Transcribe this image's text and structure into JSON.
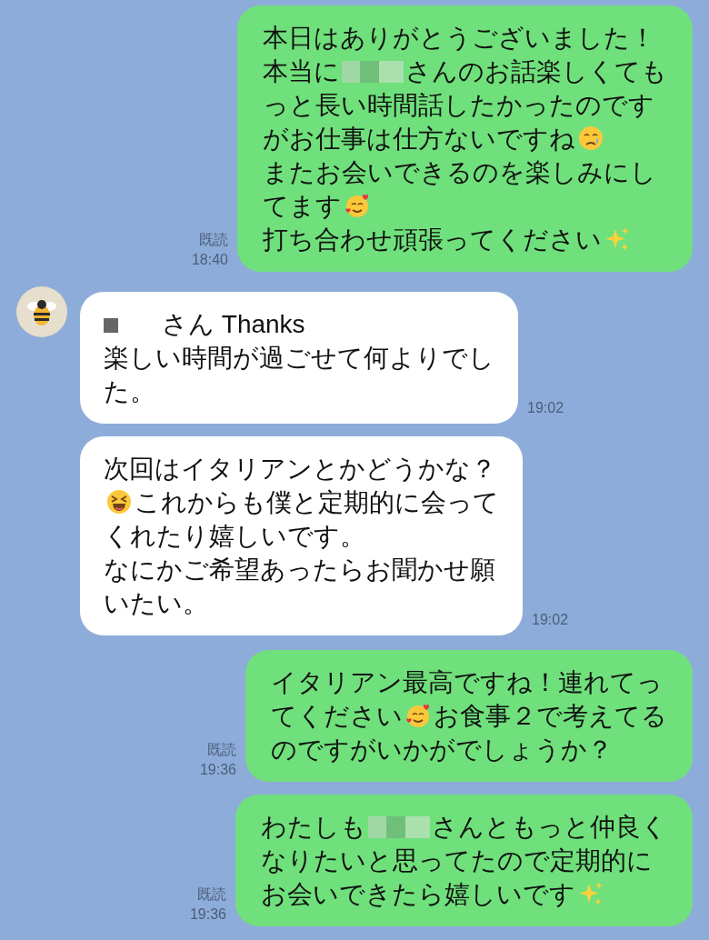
{
  "messages": [
    {
      "kind": "outgoing",
      "read_label": "既読",
      "time": "18:40",
      "lines": [
        [
          {
            "kind": "text",
            "text": "本日はありがとうございました！"
          }
        ],
        [
          {
            "kind": "text",
            "text": "本当に"
          },
          {
            "kind": "redacted-blur"
          },
          {
            "kind": "text",
            "text": "さんのお話楽しくても"
          }
        ],
        [
          {
            "kind": "text",
            "text": "っと長い時間話したかったのです"
          }
        ],
        [
          {
            "kind": "text",
            "text": "がお仕事は仕方ないですね"
          },
          {
            "kind": "emoji-cry"
          }
        ],
        [
          {
            "kind": "text",
            "text": "またお会いできるのを楽しみにし"
          }
        ],
        [
          {
            "kind": "text",
            "text": "てます"
          },
          {
            "kind": "emoji-hearts"
          }
        ],
        [
          {
            "kind": "text",
            "text": "打ち合わせ頑張ってください"
          },
          {
            "kind": "emoji-sparkles"
          }
        ]
      ]
    },
    {
      "kind": "incoming",
      "show_avatar": true,
      "time": "19:02",
      "lines": [
        [
          {
            "kind": "redacted-block"
          },
          {
            "kind": "text",
            "text": "さん Thanks"
          }
        ],
        [
          {
            "kind": "text",
            "text": "楽しい時間が過ごせて何よりでし"
          }
        ],
        [
          {
            "kind": "text",
            "text": "た。"
          }
        ]
      ]
    },
    {
      "kind": "incoming",
      "show_avatar": false,
      "time": "19:02",
      "lines": [
        [
          {
            "kind": "text",
            "text": "次回はイタリアンとかどうかな？"
          }
        ],
        [
          {
            "kind": "emoji-laugh"
          },
          {
            "kind": "text",
            "text": "これからも僕と定期的に会って"
          }
        ],
        [
          {
            "kind": "text",
            "text": "くれたり嬉しいです。"
          }
        ],
        [
          {
            "kind": "text",
            "text": "なにかご希望あったらお聞かせ願"
          }
        ],
        [
          {
            "kind": "text",
            "text": "いたい。"
          }
        ]
      ]
    },
    {
      "kind": "outgoing",
      "read_label": "既読",
      "time": "19:36",
      "lines": [
        [
          {
            "kind": "text",
            "text": "イタリアン最高ですね！連れてっ"
          }
        ],
        [
          {
            "kind": "text",
            "text": "てください"
          },
          {
            "kind": "emoji-hearts"
          },
          {
            "kind": "text",
            "text": "お食事２で考えてる"
          }
        ],
        [
          {
            "kind": "text",
            "text": "のですがいかがでしょうか？"
          }
        ]
      ]
    },
    {
      "kind": "outgoing",
      "read_label": "既読",
      "time": "19:36",
      "lines": [
        [
          {
            "kind": "text",
            "text": "わたしも"
          },
          {
            "kind": "redacted-blur"
          },
          {
            "kind": "text",
            "text": "さんともっと仲良く"
          }
        ],
        [
          {
            "kind": "text",
            "text": "なりたいと思ってたので定期的に"
          }
        ],
        [
          {
            "kind": "text",
            "text": "お会いできたら嬉しいです"
          },
          {
            "kind": "emoji-sparkles"
          }
        ]
      ]
    }
  ]
}
